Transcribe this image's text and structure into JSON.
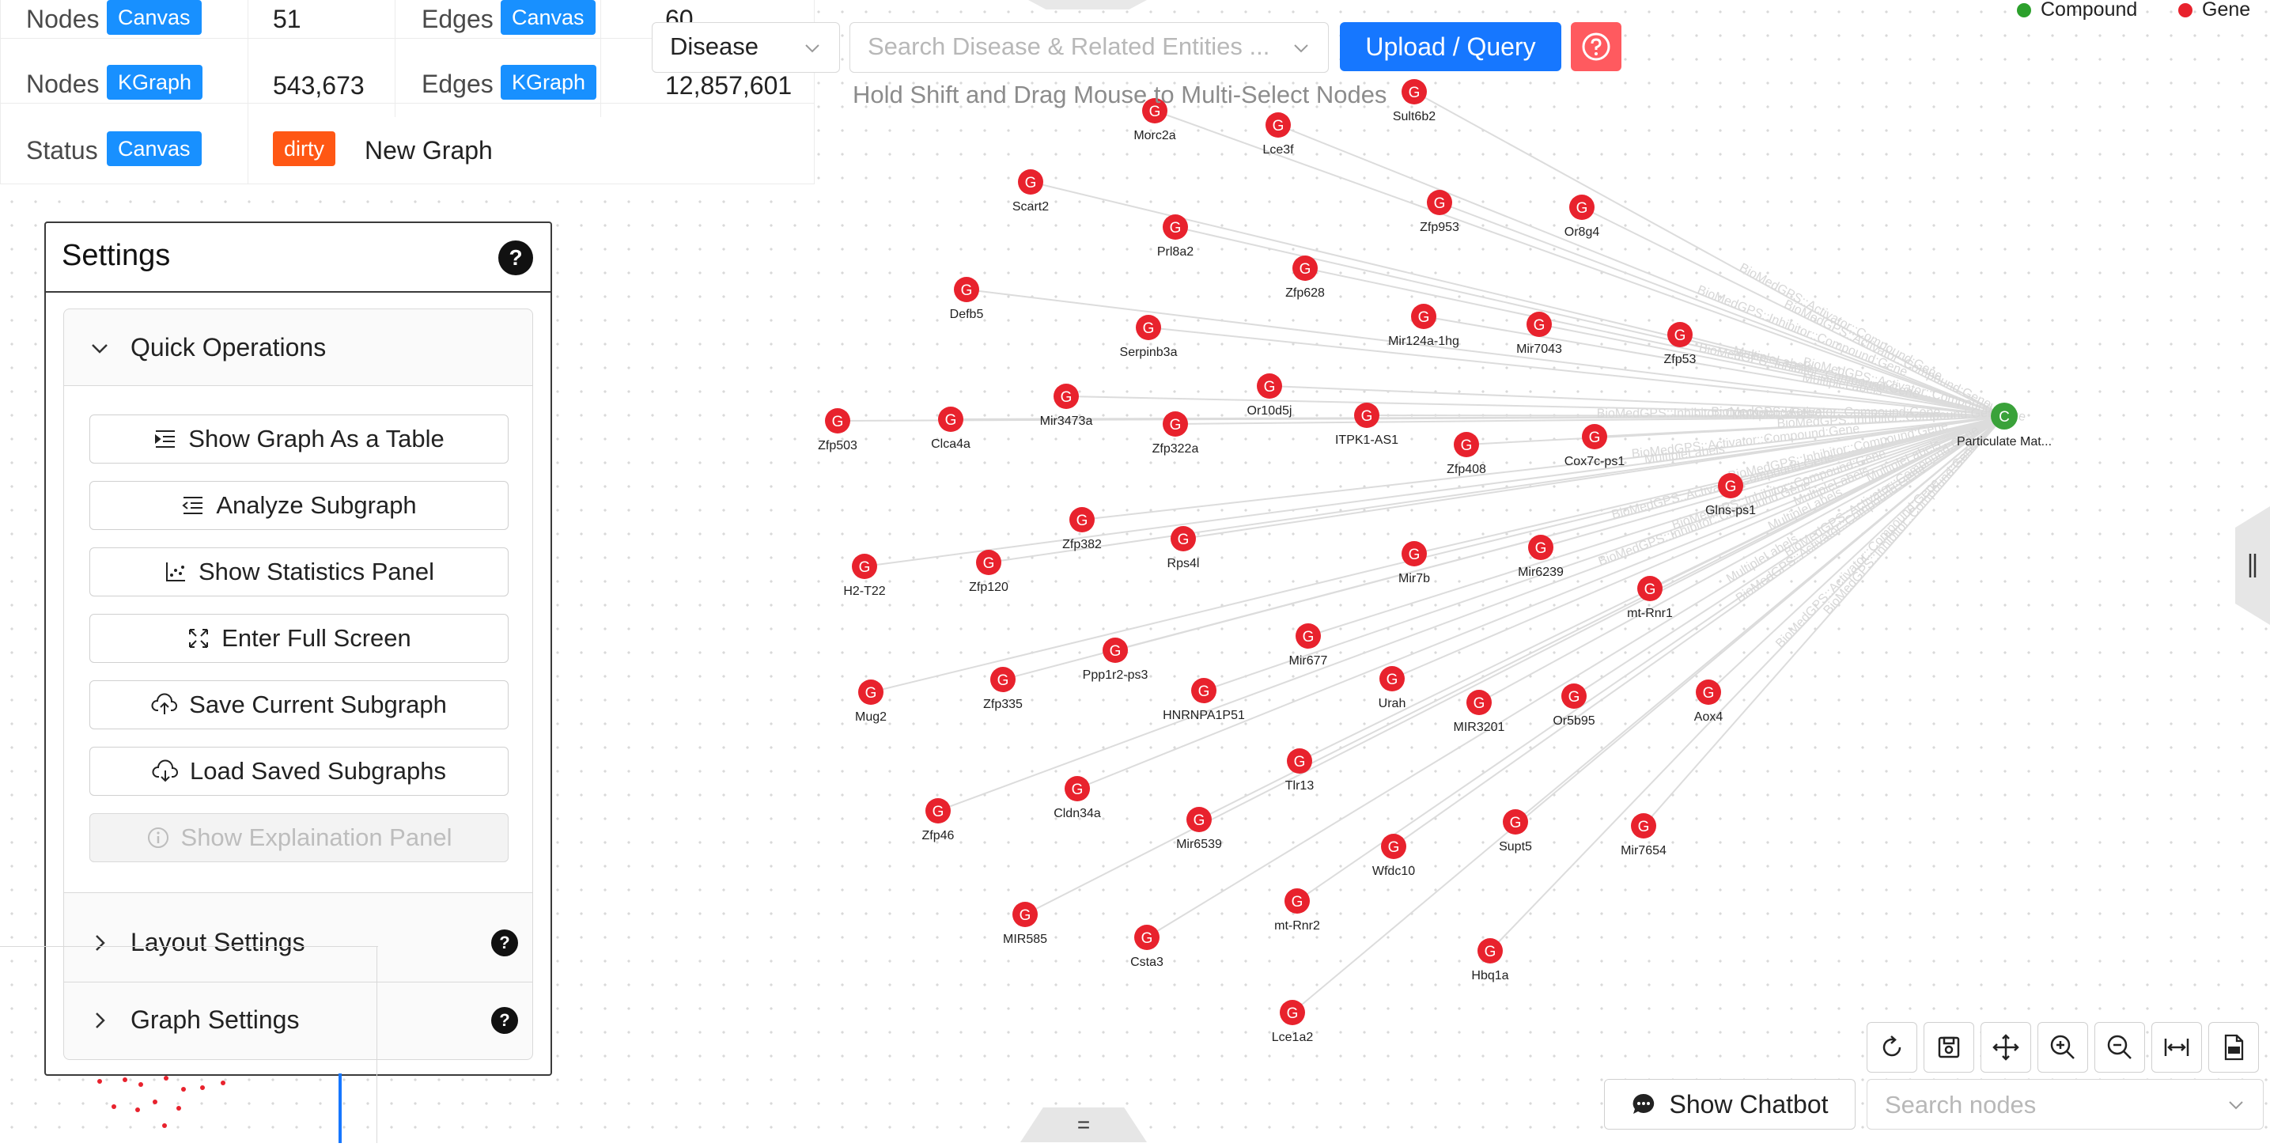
{
  "stats": {
    "rows": [
      {
        "label": "Nodes",
        "tag": "Canvas",
        "value": "51",
        "label2": "Edges",
        "tag2": "Canvas",
        "value2": "60"
      },
      {
        "label": "Nodes",
        "tag": "KGraph",
        "value": "543,673",
        "label2": "Edges",
        "tag2": "KGraph",
        "value2": "12,857,601"
      },
      {
        "label": "Status",
        "tag": "Canvas",
        "status_tag": "dirty",
        "value": "New Graph"
      }
    ]
  },
  "toolbar": {
    "entity_type": "Disease",
    "search_placeholder": "Search Disease & Related Entities ...",
    "upload_label": "Upload / Query",
    "hint": "Hold Shift and Drag Mouse to Multi-Select Nodes"
  },
  "legend": [
    {
      "label": "Compound",
      "color": "#2ca02c"
    },
    {
      "label": "Gene",
      "color": "#e8222d"
    }
  ],
  "graph": {
    "center": {
      "label": "Particulate Mat...",
      "symbol": "C",
      "color": "#3aa23a"
    },
    "gene_symbol": "G",
    "gene_color": "#e8222d",
    "edge_labels": [
      "BioMedGPS::Activator::Compound:Gene",
      "MultipleLabels",
      "BioMedGPS::Inhibitor::Compound:Gene"
    ],
    "genes": [
      "Sult6b2",
      "Morc2a",
      "Lce3f",
      "Scart2",
      "Prl8a2",
      "Zfp953",
      "Or8g4",
      "Defb5",
      "Zfp628",
      "Serpinb3a",
      "Mir124a-1hg",
      "Mir7043",
      "Zfp53",
      "Zfp503",
      "Clca4a",
      "Mir3473a",
      "Zfp322a",
      "Or10d5j",
      "ITPK1-AS1",
      "Zfp408",
      "Cox7c-ps1",
      "Glns-ps1",
      "H2-T22",
      "Zfp120",
      "Zfp382",
      "Rps4l",
      "Mir7b",
      "Mir6239",
      "mt-Rnr1",
      "Mug2",
      "Zfp335",
      "Ppp1r2-ps3",
      "HNRNPA1P51",
      "Mir677",
      "Urah",
      "MIR3201",
      "Or5b95",
      "Aox4",
      "Zfp46",
      "Cldn34a",
      "Tlr13",
      "Mir6539",
      "Wfdc10",
      "Supt5",
      "Mir7654",
      "MIR585",
      "Csta3",
      "mt-Rnr2",
      "Hbq1a",
      "Lce1a2"
    ]
  },
  "settings": {
    "title": "Settings",
    "quick_operations": "Quick Operations",
    "buttons": [
      {
        "label": "Show Graph As a Table",
        "icon": "table-icon",
        "disabled": false
      },
      {
        "label": "Analyze Subgraph",
        "icon": "analyze-icon",
        "disabled": false
      },
      {
        "label": "Show Statistics Panel",
        "icon": "statistics-icon",
        "disabled": false
      },
      {
        "label": "Enter Full Screen",
        "icon": "fullscreen-icon",
        "disabled": false
      },
      {
        "label": "Save Current Subgraph",
        "icon": "cloud-upload-icon",
        "disabled": false
      },
      {
        "label": "Load Saved Subgraphs",
        "icon": "cloud-download-icon",
        "disabled": false
      },
      {
        "label": "Show Explaination Panel",
        "icon": "info-icon",
        "disabled": true
      }
    ],
    "layout_settings": "Layout Settings",
    "graph_settings": "Graph Settings"
  },
  "bottom": {
    "tools": [
      "refresh-icon",
      "save-image-icon",
      "move-icon",
      "zoom-in-icon",
      "zoom-out-icon",
      "fit-width-icon",
      "export-png-icon"
    ],
    "chatbot_label": "Show Chatbot",
    "search_nodes_placeholder": "Search nodes",
    "handle_glyph": "="
  }
}
